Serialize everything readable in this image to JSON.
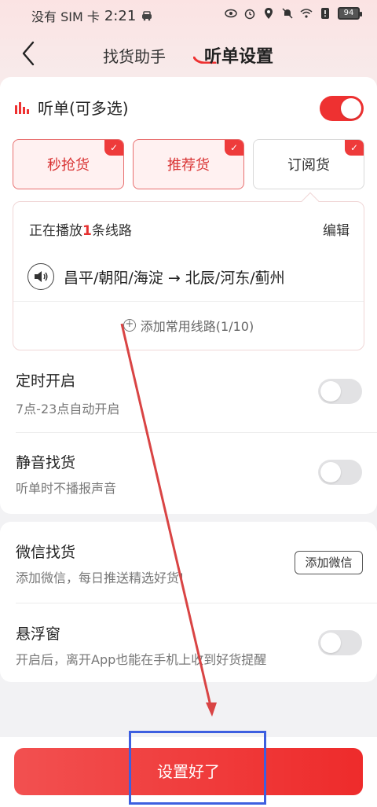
{
  "status_bar": {
    "carrier": "没有 SIM 卡",
    "time": "2:21",
    "battery": "94"
  },
  "header": {
    "back_icon": "chevron-left-icon",
    "tabs": [
      {
        "label": "找货助手",
        "active": false
      },
      {
        "label": "听单设置",
        "active": true
      }
    ]
  },
  "listen": {
    "icon": "bar-chart-icon",
    "title": "听单(可多选)",
    "enabled": true,
    "chips": [
      {
        "label": "秒抢货",
        "selected": true
      },
      {
        "label": "推荐货",
        "selected": true
      },
      {
        "label": "订阅货",
        "selected": false
      }
    ]
  },
  "routes": {
    "playing_prefix": "正在播放",
    "playing_count": "1",
    "playing_suffix": "条线路",
    "edit_label": "编辑",
    "speaker_icon": "speaker-icon",
    "route_text": "昌平/朝阳/海淀 → 北辰/河东/蓟州",
    "add_label": "添加常用线路(1/10)"
  },
  "settings": [
    {
      "title": "定时开启",
      "subtitle": "7点-23点自动开启",
      "enabled": false
    },
    {
      "title": "静音找货",
      "subtitle": "听单时不播报声音",
      "enabled": false
    }
  ],
  "wechat": {
    "title": "微信找货",
    "subtitle": "添加微信，每日推送精选好货!",
    "button": "添加微信"
  },
  "floating": {
    "title": "悬浮窗",
    "subtitle": "开启后，离开App也能在手机上收到好货提醒",
    "enabled": false
  },
  "footer": {
    "done_label": "设置好了"
  },
  "colors": {
    "accent": "#ee3131",
    "annotation_arrow": "#d94444",
    "annotation_box": "#3d5fe0"
  }
}
